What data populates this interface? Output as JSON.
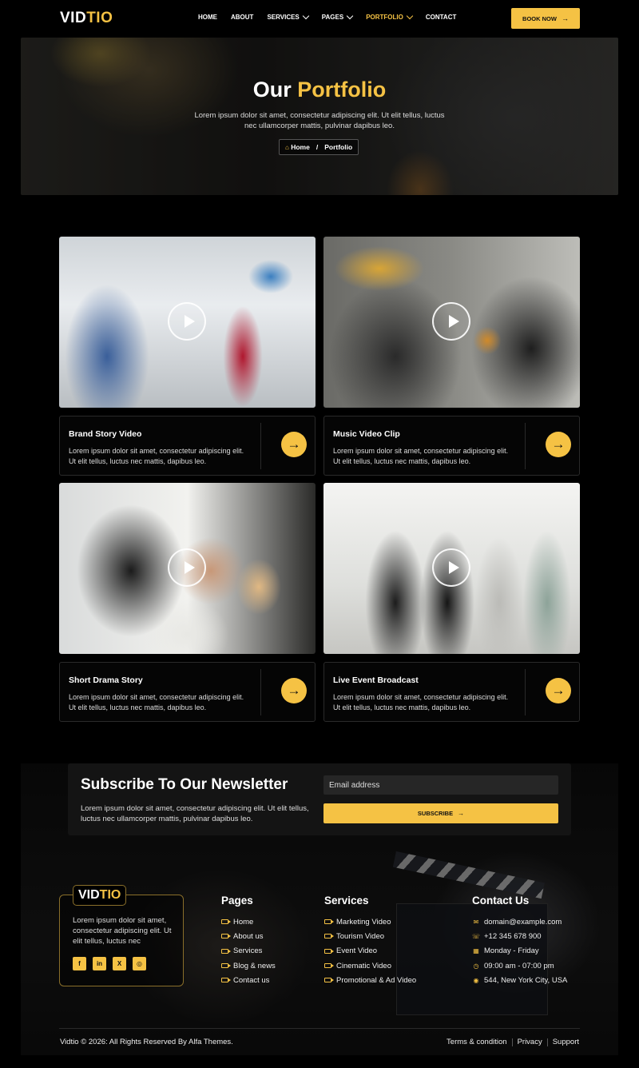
{
  "brand": {
    "logo_part1": "VID",
    "logo_part2": "TIO"
  },
  "nav": {
    "items": [
      {
        "label": "HOME"
      },
      {
        "label": "ABOUT"
      },
      {
        "label": "SERVICES"
      },
      {
        "label": "PAGES"
      },
      {
        "label": "PORTFOLIO"
      },
      {
        "label": "CONTACT"
      }
    ],
    "cta_label": "BOOK NOW"
  },
  "hero": {
    "title_part1": "Our",
    "title_part2": "Portfolio",
    "text": "Lorem ipsum dolor sit amet, consectetur adipiscing elit. Ut elit tellus, luctus nec ullamcorper mattis, pulvinar dapibus leo.",
    "breadcrumb": {
      "home": "Home",
      "separator": "/",
      "current": "Portfolio"
    }
  },
  "portfolio": [
    {
      "title": "Brand Story Video",
      "text": "Lorem ipsum dolor sit amet, consectetur adipiscing elit. Ut elit tellus, luctus nec mattis, dapibus leo."
    },
    {
      "title": "Music Video Clip",
      "text": "Lorem ipsum dolor sit amet, consectetur adipiscing elit. Ut elit tellus, luctus nec mattis, dapibus leo."
    },
    {
      "title": "Short Drama Story",
      "text": "Lorem ipsum dolor sit amet, consectetur adipiscing elit. Ut elit tellus, luctus nec mattis, dapibus leo."
    },
    {
      "title": "Live Event Broadcast",
      "text": "Lorem ipsum dolor sit amet, consectetur adipiscing elit. Ut elit tellus, luctus nec mattis, dapibus leo."
    }
  ],
  "newsletter": {
    "title": "Subscribe To Our Newsletter",
    "text": "Lorem ipsum dolor sit amet, consectetur adipiscing elit. Ut elit tellus, luctus nec ullamcorper mattis, pulvinar dapibus leo.",
    "email_placeholder": "Email address",
    "button_label": "SUBSCRIBE"
  },
  "footer": {
    "about": "Lorem ipsum dolor sit amet, consectetur adipiscing elit. Ut elit tellus, luctus nec",
    "socials": [
      "facebook-icon",
      "linkedin-icon",
      "x-icon",
      "instagram-icon"
    ],
    "pages": {
      "title": "Pages",
      "items": [
        "Home",
        "About us",
        "Services",
        "Blog & news",
        "Contact us"
      ]
    },
    "services": {
      "title": "Services",
      "items": [
        "Marketing Video",
        "Tourism Video",
        "Event Video",
        "Cinematic Video",
        "Promotional & Ad Video"
      ]
    },
    "contact": {
      "title": "Contact Us",
      "items": [
        {
          "icon": "email-icon",
          "text": "domain@example.com"
        },
        {
          "icon": "phone-icon",
          "text": "+12 345 678 900"
        },
        {
          "icon": "calendar-icon",
          "text": "Monday - Friday"
        },
        {
          "icon": "clock-icon",
          "text": "09:00 am - 07:00 pm"
        },
        {
          "icon": "location-icon",
          "text": "544, New York City, USA"
        }
      ]
    },
    "copyright": "Vidtio © 2026: All Rights Reserved By Alfa Themes.",
    "legal": [
      "Terms & condition",
      "Privacy",
      "Support"
    ]
  },
  "colors": {
    "accent": "#f5c244",
    "background": "#000000",
    "panel": "#141414"
  }
}
